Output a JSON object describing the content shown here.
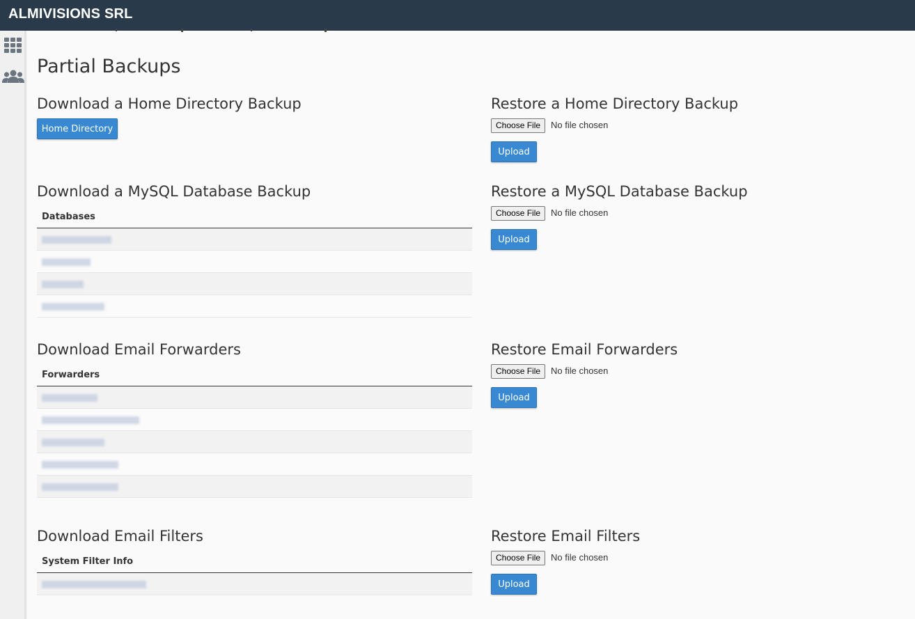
{
  "header": {
    "brand": "ALMIVISIONS SRL"
  },
  "sidebar": {
    "icons": [
      "grid-icon",
      "users-icon"
    ]
  },
  "page": {
    "title": "Partial Backups"
  },
  "sections": {
    "home": {
      "download_title": "Download a Home Directory Backup",
      "download_button": "Home Directory",
      "restore_title": "Restore a Home Directory Backup"
    },
    "mysql": {
      "download_title": "Download a MySQL Database Backup",
      "table_header": "Databases",
      "restore_title": "Restore a MySQL Database Backup"
    },
    "forwarders": {
      "download_title": "Download Email Forwarders",
      "table_header": "Forwarders",
      "restore_title": "Restore Email Forwarders"
    },
    "filters": {
      "download_title": "Download Email Filters",
      "table_header": "System Filter Info",
      "restore_title": "Restore Email Filters"
    }
  },
  "file_input": {
    "button": "Choose File",
    "status": "No file chosen"
  },
  "upload_label": "Upload",
  "colors": {
    "topbar": "#293a4a",
    "primary": "#3888d2",
    "background": "#fafafa"
  }
}
